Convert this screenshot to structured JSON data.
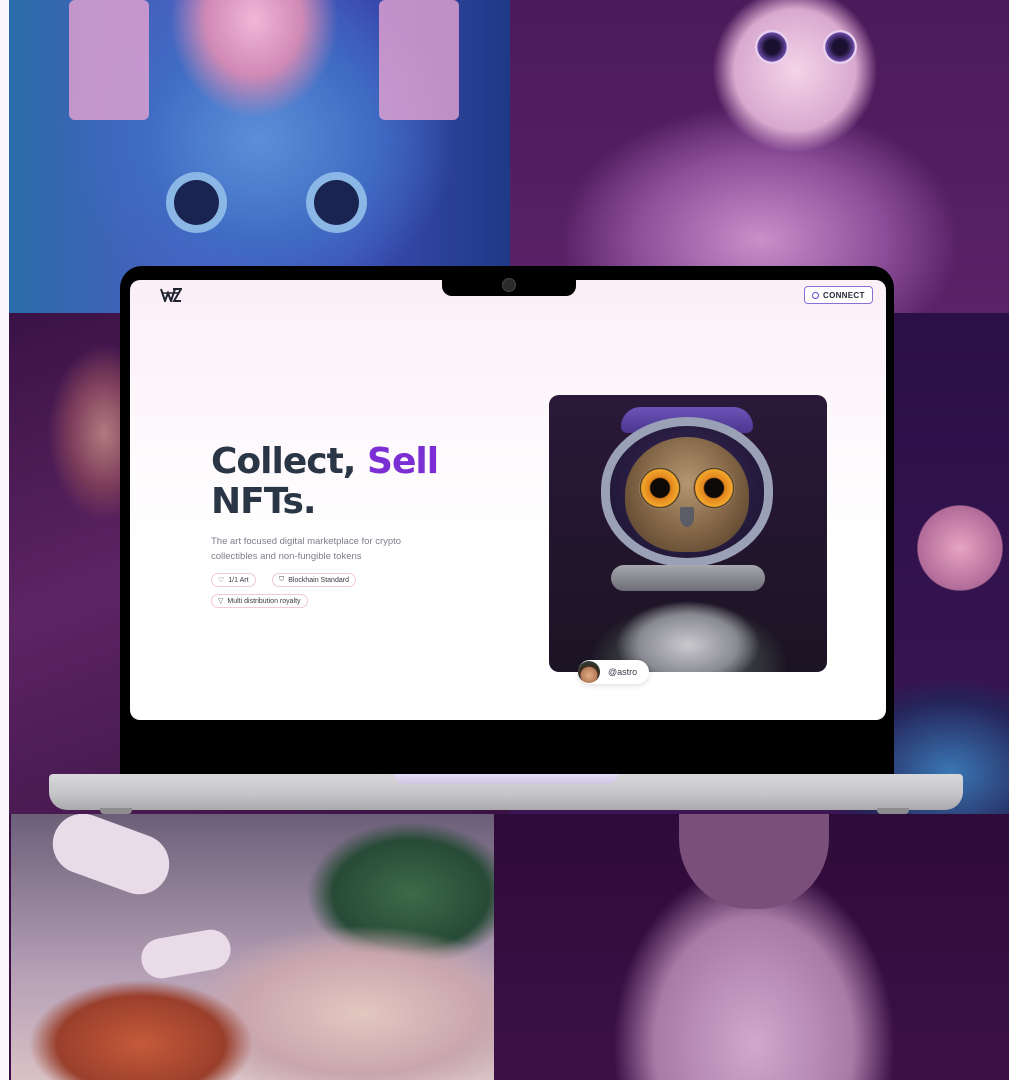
{
  "background_tiles": [
    {
      "name": "astronaut-blue"
    },
    {
      "name": "cat-astronaut"
    },
    {
      "name": "astronaut-profile"
    },
    {
      "name": "spaceship-console-moon"
    },
    {
      "name": "astronaut-lounging-beach"
    },
    {
      "name": "astronaut-praying"
    }
  ],
  "nav": {
    "logo_icon": "wl-logo-icon",
    "connect_icon": "circle-icon",
    "connect_label": "CONNECT"
  },
  "hero": {
    "title_part1": "Collect,",
    "title_accent": "Sell",
    "title_part2": "NFTs.",
    "subtitle": "The art focused digital marketplace for crypto collectibles and non-fungible tokens",
    "chips": [
      {
        "icon": "heart-icon",
        "label": "1/1 Art"
      },
      {
        "icon": "shield-icon",
        "label": "Blockhain Standard"
      },
      {
        "icon": "funnel-icon",
        "label": "Multi distribution royalty"
      }
    ]
  },
  "featured": {
    "image": "owl-astronaut",
    "creator_handle": "@astro"
  },
  "colors": {
    "accent": "#7a2ed3",
    "heading": "#2a3646",
    "connect_border": "#8b6fd6"
  }
}
